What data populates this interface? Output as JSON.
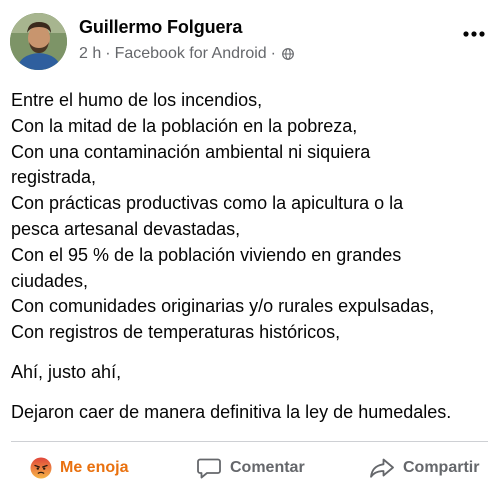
{
  "post": {
    "author": "Guillermo Folguera",
    "time": "2 h",
    "separator": "·",
    "source": "Facebook for Android",
    "separator2": "·",
    "icons": {
      "avatar": "user-photo",
      "privacy": "globe-icon",
      "more": "more-options-icon"
    },
    "body_lines": [
      "Entre el humo de los incendios,",
      "Con la mitad de la población en la pobreza,",
      "Con una contaminación ambiental ni siquiera",
      "registrada,",
      "Con prácticas productivas como la apicultura o la",
      "pesca artesanal devastadas,",
      "Con el 95 % de la población viviendo en grandes",
      "ciudades,",
      "Con comunidades originarias y/o rurales expulsadas,",
      "Con registros de temperaturas históricos,"
    ],
    "paragraph2": "Ahí, justo ahí,",
    "paragraph3": "Dejaron caer de manera definitiva la ley de humedales."
  },
  "actions": {
    "react_label": "Me enoja",
    "comment_label": "Comentar",
    "share_label": "Compartir",
    "icons": {
      "react": "angry-emoji-icon",
      "comment": "comment-bubble-icon",
      "share": "share-arrow-icon"
    }
  },
  "colors": {
    "reaction_accent": "#e9710f",
    "secondary_text": "#65676b",
    "text": "#050505"
  }
}
